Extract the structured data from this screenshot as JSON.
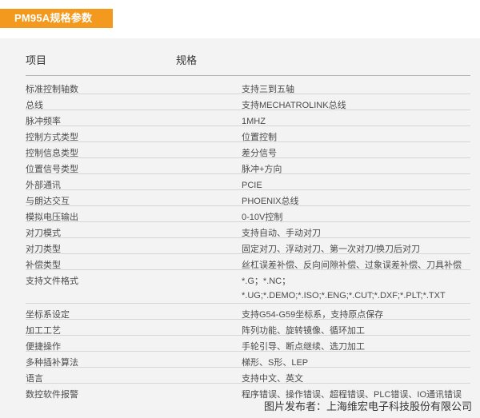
{
  "header": {
    "title": "PM95A规格参数"
  },
  "table": {
    "columns": [
      "项目",
      "规格"
    ],
    "rows": [
      {
        "item": "标准控制轴数",
        "spec": "支持三到五轴"
      },
      {
        "item": "总线",
        "spec": "支持MECHATROLINK总线"
      },
      {
        "item": "脉冲频率",
        "spec": "1MHZ"
      },
      {
        "item": "控制方式类型",
        "spec": "位置控制"
      },
      {
        "item": "控制信息类型",
        "spec": "差分信号"
      },
      {
        "item": "位置信号类型",
        "spec": "脉冲+方向"
      },
      {
        "item": "外部通讯",
        "spec": "PCIE"
      },
      {
        "item": "与朗达交互",
        "spec": "PHOENIX总线"
      },
      {
        "item": "模拟电压输出",
        "spec": "0-10V控制"
      },
      {
        "item": "对刀模式",
        "spec": "支持自动、手动对刀"
      },
      {
        "item": "对刀类型",
        "spec": "固定对刀、浮动对刀、第一次对刀/换刀后对刀"
      },
      {
        "item": "补偿类型",
        "spec": "丝杠误差补偿、反向间隙补偿、过象误差补偿、刀具补偿"
      },
      {
        "item": "支持文件格式",
        "spec": "*.G；*.NC；*.UG;*.DEMO;*.ISO;*.ENG;*.CUT;*.DXF;*.PLT;*.TXT"
      },
      {
        "item": "坐标系设定",
        "spec": "支持G54-G59坐标系，支持原点保存"
      },
      {
        "item": "加工工艺",
        "spec": "阵列功能、旋转镜像、循环加工"
      },
      {
        "item": "便捷操作",
        "spec": "手轮引导、断点继续、选刀加工"
      },
      {
        "item": "多种插补算法",
        "spec": "梯形、S形、LEP"
      },
      {
        "item": "语言",
        "spec": "支持中文、英文"
      },
      {
        "item": "数控软件报警",
        "spec": "程序错误、操作错误、超程错误、PLC错误、IO通讯错误"
      }
    ]
  },
  "footer": {
    "caption": "图片发布者：上海维宏电子科技股份有限公司"
  },
  "colors": {
    "accent": "#f39a1e",
    "panel": "#f3f3f4"
  }
}
